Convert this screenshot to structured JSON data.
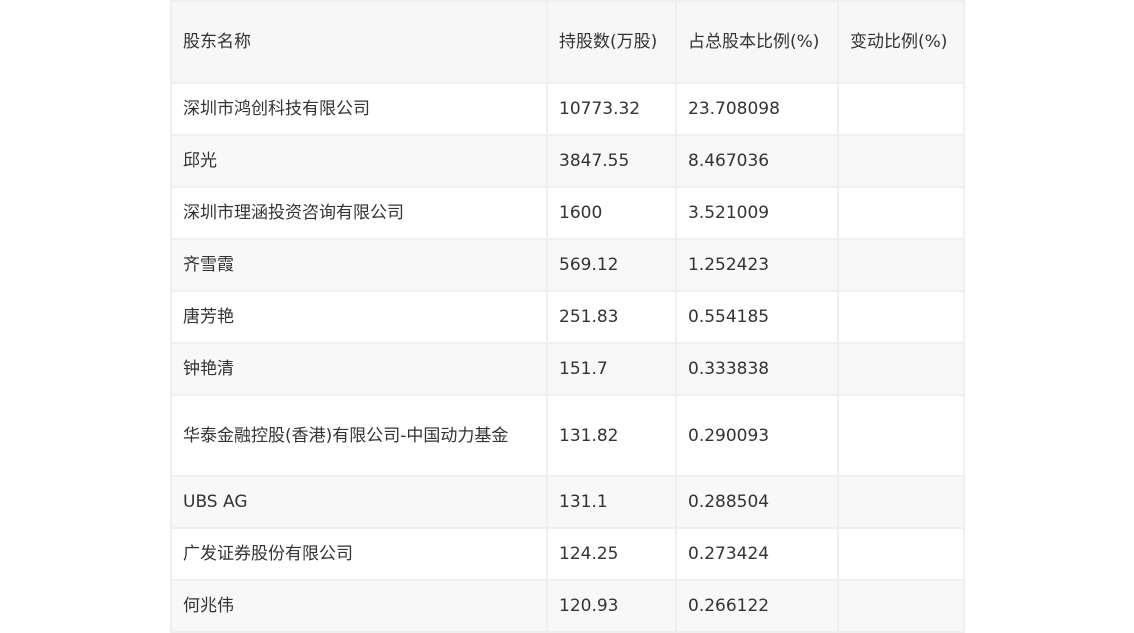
{
  "table": {
    "headers": [
      "股东名称",
      "持股数(万股)",
      "占总股本比例(%)",
      "变动比例(%)"
    ],
    "rows": [
      {
        "name": "深圳市鸿创科技有限公司",
        "shares": "10773.32",
        "ratio": "23.708098",
        "change": ""
      },
      {
        "name": "邱光",
        "shares": "3847.55",
        "ratio": "8.467036",
        "change": ""
      },
      {
        "name": "深圳市理涵投资咨询有限公司",
        "shares": "1600",
        "ratio": "3.521009",
        "change": ""
      },
      {
        "name": "齐雪霞",
        "shares": "569.12",
        "ratio": "1.252423",
        "change": ""
      },
      {
        "name": "唐芳艳",
        "shares": "251.83",
        "ratio": "0.554185",
        "change": ""
      },
      {
        "name": "钟艳清",
        "shares": "151.7",
        "ratio": "0.333838",
        "change": ""
      },
      {
        "name": "华泰金融控股(香港)有限公司-中国动力基金",
        "shares": "131.82",
        "ratio": "0.290093",
        "change": ""
      },
      {
        "name": "UBS AG",
        "shares": "131.1",
        "ratio": "0.288504",
        "change": ""
      },
      {
        "name": "广发证券股份有限公司",
        "shares": "124.25",
        "ratio": "0.273424",
        "change": ""
      },
      {
        "name": "何兆伟",
        "shares": "120.93",
        "ratio": "0.266122",
        "change": ""
      }
    ]
  }
}
